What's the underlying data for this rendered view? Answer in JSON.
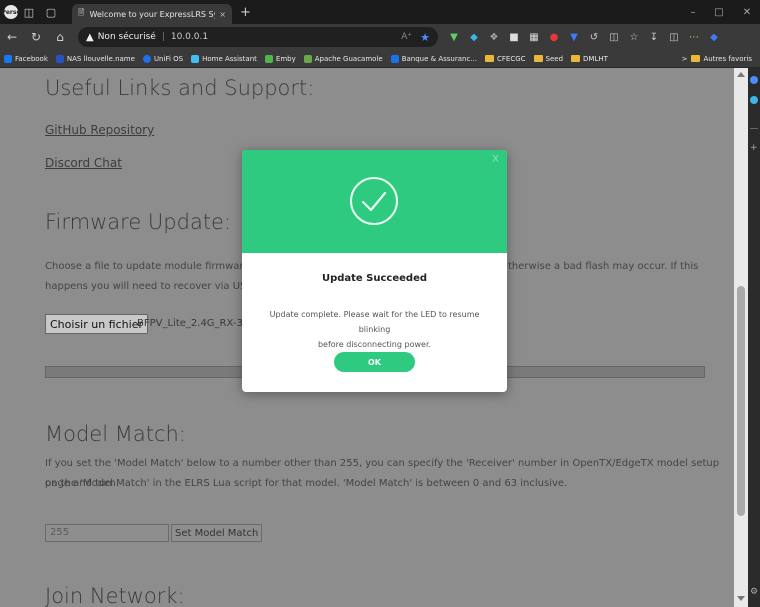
{
  "browser": {
    "profile_label": "Perso",
    "tab_title": "Welcome to your ExpressLRS Sy...",
    "tab_close": "×",
    "new_tab": "+",
    "address": {
      "security_label": "Non sécurisé",
      "url": "10.0.0.1"
    },
    "bookmarks": [
      {
        "label": "Facebook",
        "color": "#1877f2"
      },
      {
        "label": "NAS llouvelle.name",
        "color": "#2a52be"
      },
      {
        "label": "UniFi OS",
        "color": "#1f6feb"
      },
      {
        "label": "Home Assistant",
        "color": "#41bdf5"
      },
      {
        "label": "Emby",
        "color": "#52b54b"
      },
      {
        "label": "Apache Guacamole",
        "color": "#6aa84f"
      },
      {
        "label": "Banque & Assuranc...",
        "color": "#1a73e8"
      },
      {
        "label": "CFECGC",
        "color": "#e8b73c"
      },
      {
        "label": "Seed",
        "color": "#e8b73c"
      },
      {
        "label": "DMLHT",
        "color": "#e8b73c"
      }
    ],
    "other_bookmarks": "Autres favoris"
  },
  "page": {
    "useful_links": {
      "heading": "Useful Links and Support:",
      "github": "GitHub Repository",
      "discord": "Discord Chat"
    },
    "firmware": {
      "heading": "Firmware Update:",
      "text_line1_left": "Choose a file to update module firmware. Sel",
      "text_line1_right": "therwise a bad flash may occur. If this",
      "text_line2": "happens you will need to recover via USB/Se",
      "file_button": "Choisir un fichier",
      "file_name": "BFPV_Lite_2.4G_RX-3.3"
    },
    "model_match": {
      "heading": "Model Match:",
      "text_line1": "If you set the 'Model Match' below to a number other than 255, you can specify the 'Receiver' number in OpenTX/EdgeTX model setup page and turn",
      "text_line2": "on the 'Model Match' in the ELRS Lua script for that model. 'Model Match' is between 0 and 63 inclusive.",
      "input_value": "255",
      "button": "Set Model Match"
    },
    "join_network": {
      "heading": "Join Network:"
    }
  },
  "modal": {
    "close": "X",
    "title": "Update Succeeded",
    "message_line1": "Update complete. Please wait for the LED to resume blinking",
    "message_line2": "before disconnecting power.",
    "ok_button": "OK",
    "accent_color": "#2dca80"
  }
}
